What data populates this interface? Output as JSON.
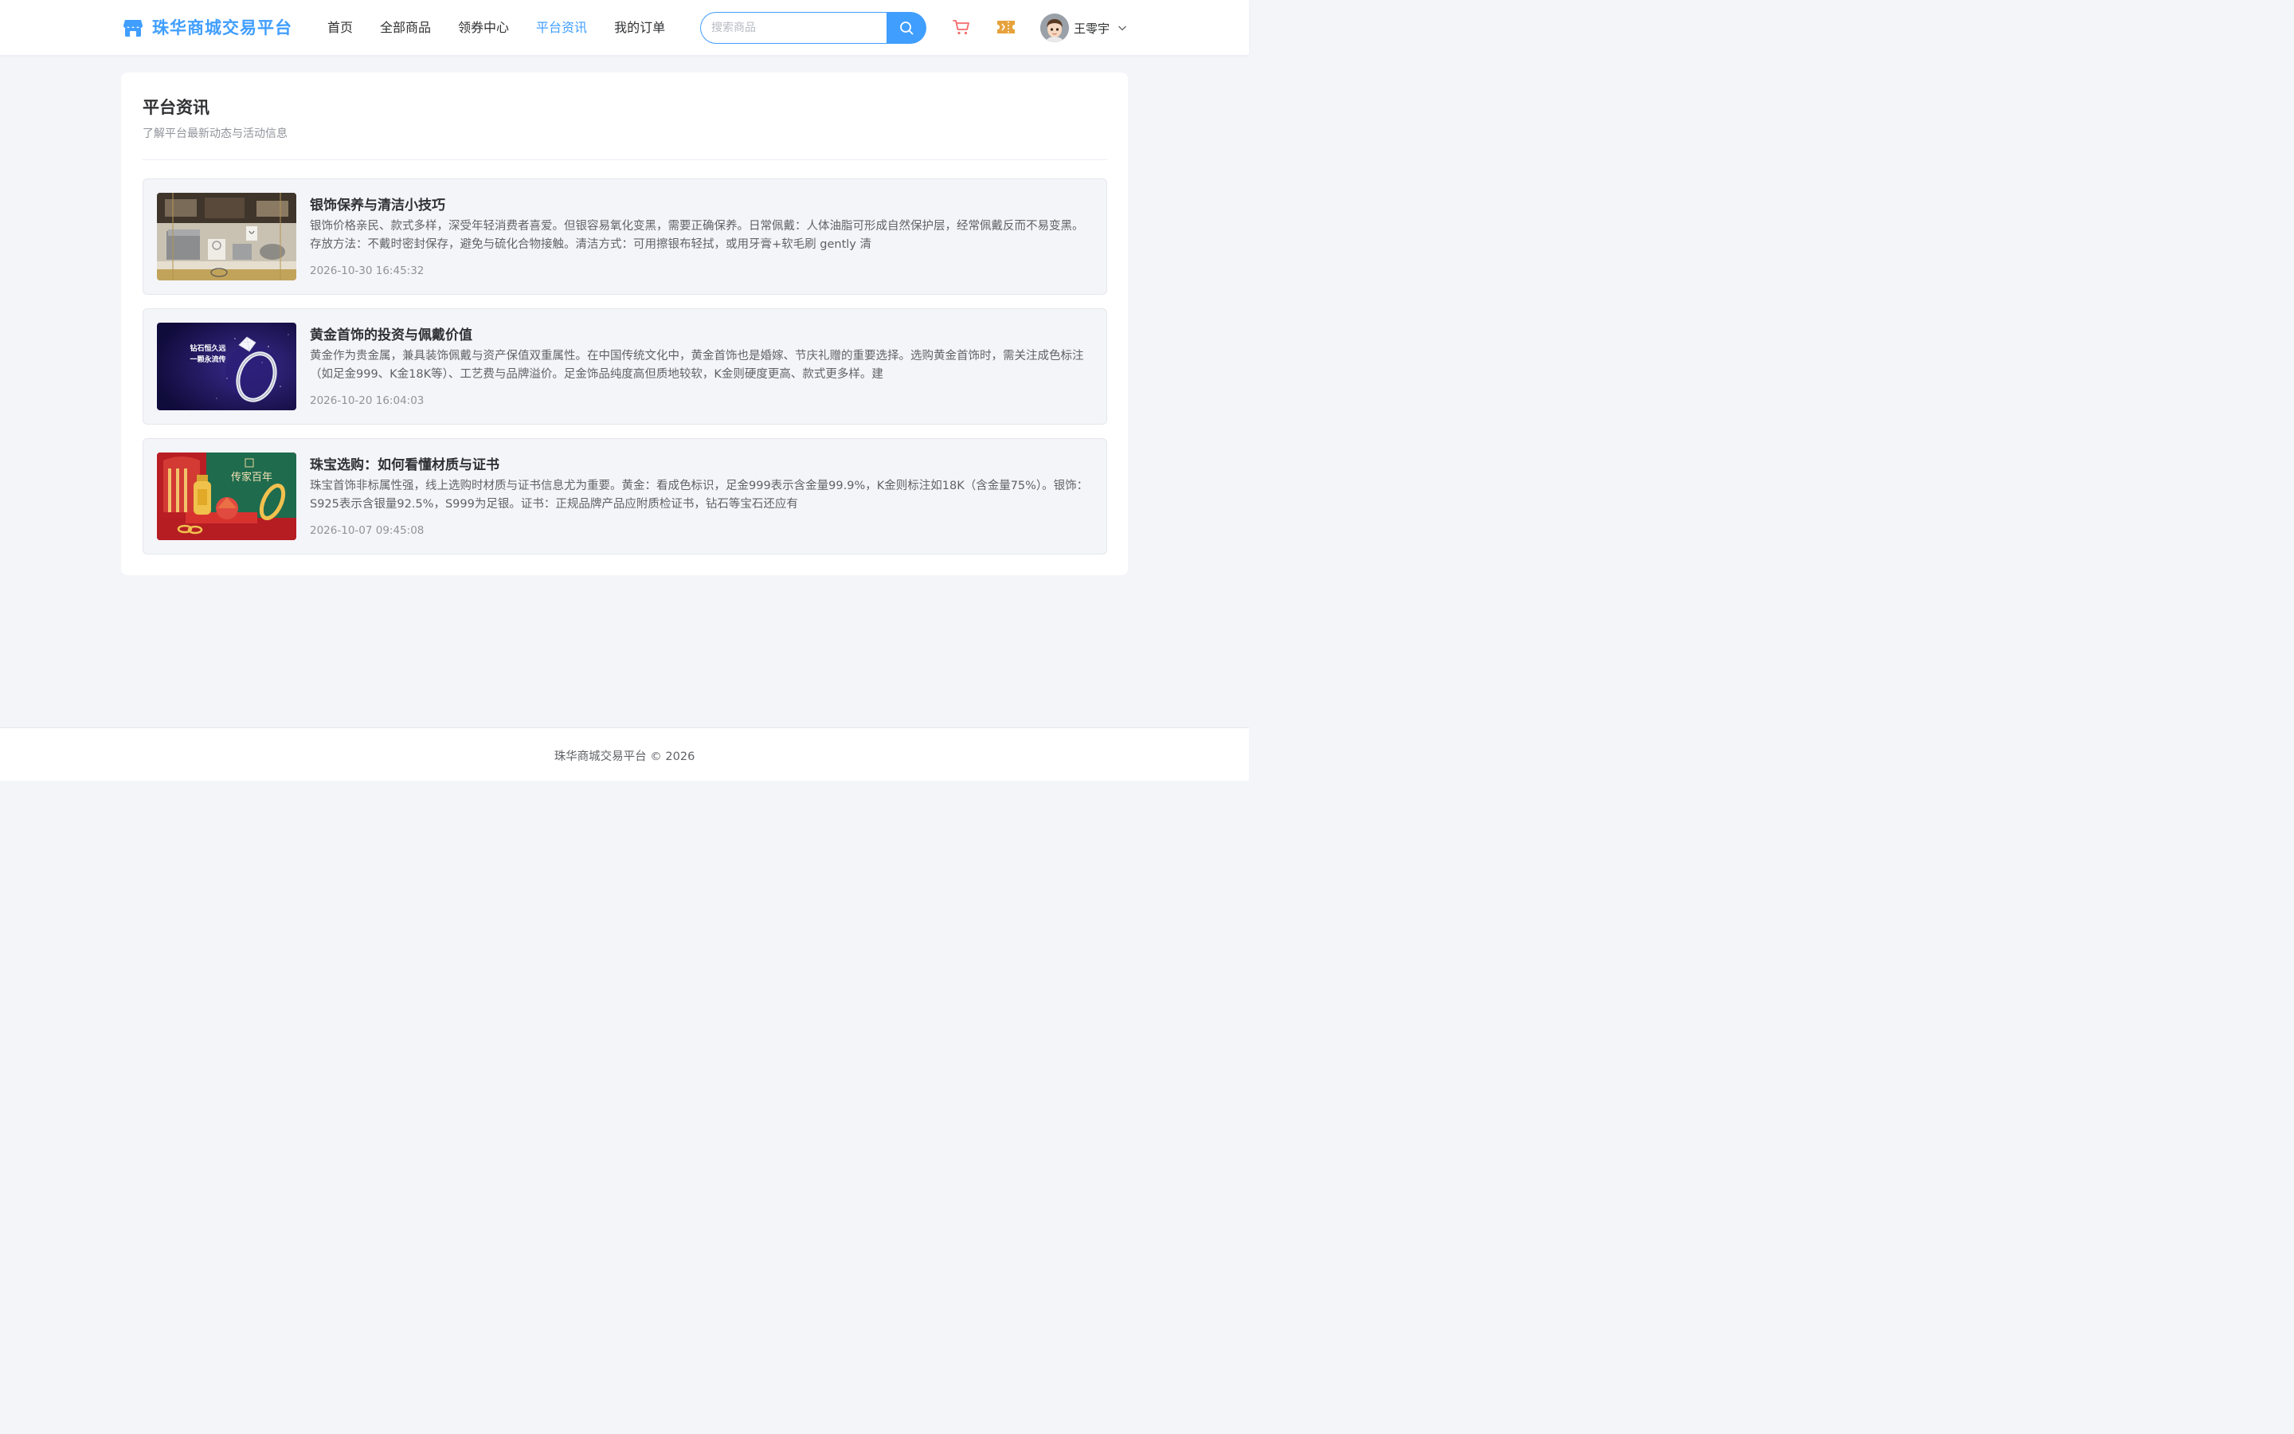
{
  "brand": {
    "name": "珠华商城交易平台",
    "accent": "#409eff"
  },
  "nav": {
    "items": [
      {
        "label": "首页",
        "active": false
      },
      {
        "label": "全部商品",
        "active": false
      },
      {
        "label": "领券中心",
        "active": false
      },
      {
        "label": "平台资讯",
        "active": true
      },
      {
        "label": "我的订单",
        "active": false
      }
    ]
  },
  "search": {
    "placeholder": "搜索商品",
    "value": ""
  },
  "icons": {
    "logo": "shop-icon",
    "search": "search-icon",
    "cart": "cart-icon",
    "coupon": "coupon-icon",
    "user_menu": "chevron-down-icon"
  },
  "user": {
    "name": "王零宇"
  },
  "page": {
    "title": "平台资讯",
    "subtitle": "了解平台最新动态与活动信息"
  },
  "news": [
    {
      "title": "银饰保养与清洁小技巧",
      "summary": "银饰价格亲民、款式多样，深受年轻消费者喜爱。但银容易氧化变黑，需要正确保养。日常佩戴：人体油脂可形成自然保护层，经常佩戴反而不易变黑。存放方法：不戴时密封保存，避免与硫化合物接触。清洁方式：可用擦银布轻拭，或用牙膏+软毛刷 gently 清",
      "date": "2026-10-30 16:45:32",
      "thumb": "jewelry-display-photo"
    },
    {
      "title": "黄金首饰的投资与佩戴价值",
      "summary": "黄金作为贵金属，兼具装饰佩戴与资产保值双重属性。在中国传统文化中，黄金首饰也是婚嫁、节庆礼赠的重要选择。选购黄金首饰时，需关注成色标注（如足金999、K金18K等）、工艺费与品牌溢价。足金饰品纯度高但质地较软，K金则硬度更高、款式更多样。建",
      "date": "2026-10-20 16:04:03",
      "thumb": "diamond-ring-banner",
      "thumb_text": [
        "钻石恒久远",
        "一颗永流传"
      ]
    },
    {
      "title": "珠宝选购：如何看懂材质与证书",
      "summary": "珠宝首饰非标属性强，线上选购时材质与证书信息尤为重要。黄金：看成色标识，足金999表示含金量99.9%，K金则标注如18K（含金量75%）。银饰：S925表示含银量92.5%，S999为足银。证书：正规品牌产品应附质检证书，钻石等宝石还应有",
      "date": "2026-10-07 09:45:08",
      "thumb": "gold-jewelry-banner",
      "thumb_text": [
        "传家百年"
      ]
    }
  ],
  "footer": {
    "text": "珠华商城交易平台 © 2026"
  }
}
